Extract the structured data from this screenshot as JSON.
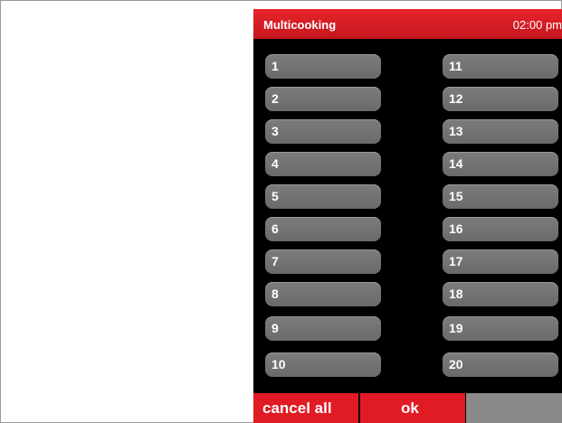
{
  "header": {
    "title": "Multicooking",
    "time": "02:00 pm"
  },
  "slots_left": [
    "1",
    "2",
    "3",
    "4",
    "5",
    "6",
    "7",
    "8",
    "9",
    "10"
  ],
  "slots_right": [
    "11",
    "12",
    "13",
    "14",
    "15",
    "16",
    "17",
    "18",
    "19",
    "20"
  ],
  "footer": {
    "cancel_label": "cancel all",
    "ok_label": "ok"
  },
  "colors": {
    "accent_red": "#e01b24",
    "slot_grey": "#737373",
    "background": "#000000"
  }
}
